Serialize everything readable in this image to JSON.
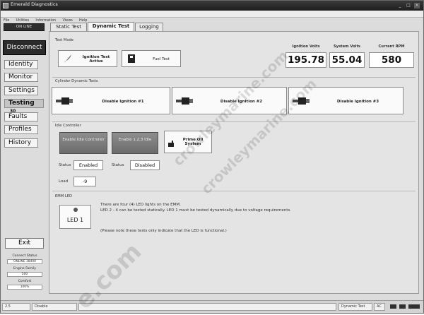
{
  "window": {
    "title": "Emerald Diagnostics"
  },
  "menu": [
    "File",
    "Utilities",
    "Information",
    "Views",
    "Help"
  ],
  "sidebar": {
    "connection": "ON LINE",
    "disconnect": "Disconnect",
    "items": [
      {
        "label": "Identity"
      },
      {
        "label": "Monitor"
      },
      {
        "label": "Settings"
      },
      {
        "label": "Testing"
      },
      {
        "label": "Faults"
      },
      {
        "label": "Profiles"
      },
      {
        "label": "History"
      }
    ],
    "testing_badge": "30",
    "exit": "Exit",
    "status_fields": [
      {
        "label": "Connect Status",
        "value": "ONLINE 38400"
      },
      {
        "label": "Engine Family",
        "value": "500"
      },
      {
        "label": "Comfort",
        "value": "100%"
      }
    ]
  },
  "tabs": [
    "Static Test",
    "Dynamic Test",
    "Logging"
  ],
  "test_mode": {
    "label": "Test Mode",
    "ignition_button": "Ignition Test Active",
    "fuel_button": "Fuel Test"
  },
  "readouts": [
    {
      "label": "Ignition Volts",
      "value": "195.78"
    },
    {
      "label": "System Volts",
      "value": "55.04"
    },
    {
      "label": "Current RPM",
      "value": "580"
    }
  ],
  "cylinder": {
    "label": "Cylinder Dynamic Tests",
    "buttons": [
      "Disable Ignition #1",
      "Disable Ignition #2",
      "Disable Ignition #3"
    ]
  },
  "idle": {
    "label": "Idle Controller",
    "enable_idle": "Enable Idle Controller",
    "enable_123": "Enable 1,2,3 Idle",
    "prime": "Prime Oil System",
    "status_label": "Status",
    "status_value": "Enabled",
    "status2_value": "Disabled",
    "load_label": "Load",
    "load_value": "-9"
  },
  "emm": {
    "label": "EMM LED",
    "led_button": "LED 1",
    "text1": "There are four (4) LED lights on the EMM.",
    "text2": "LED 2 - 4 can be tested statically. LED 1 must be tested dynamically due to voltage requirements.",
    "text3": "(Please note these tests only indicate that the LED is functional.)"
  },
  "statusbar": {
    "left": "2.5",
    "mid": "Disable",
    "right_label": "Dynamic Test",
    "right_value": "AC"
  },
  "watermarks": [
    "crowleymarine.com",
    "crowleymarine.com",
    "e.com"
  ],
  "colors": {
    "dark": "#2b2b2b",
    "panel": "#e4e4e4",
    "button": "#fafafa"
  }
}
